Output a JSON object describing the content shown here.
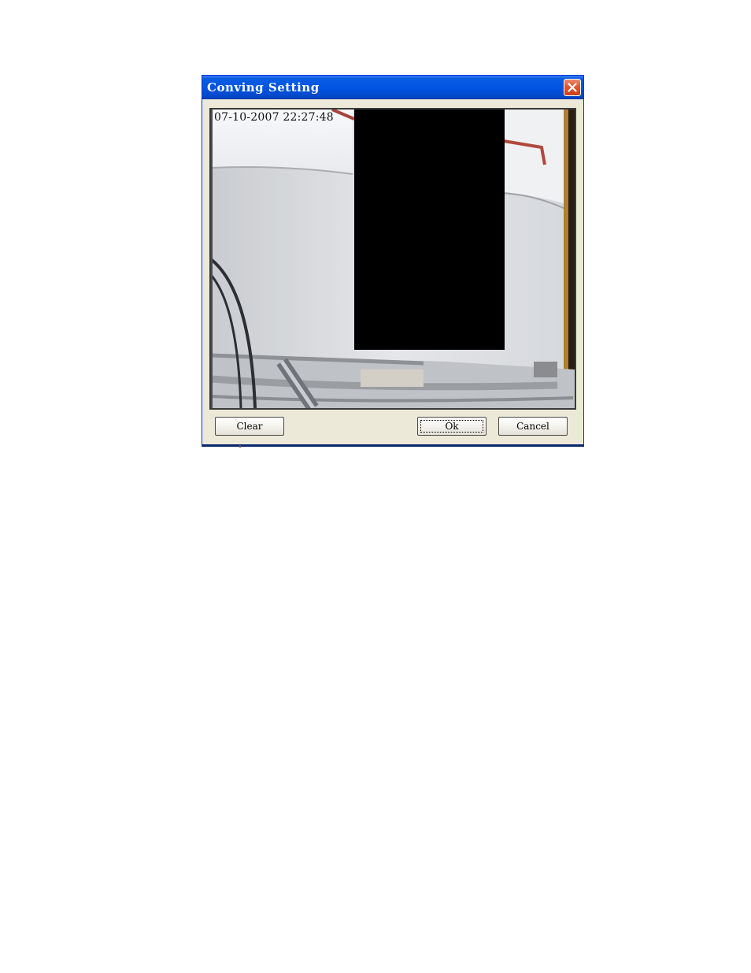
{
  "window": {
    "title": "Conving Setting"
  },
  "video": {
    "timestamp": "07-10-2007 22:27:48"
  },
  "buttons": {
    "clear": "Clear",
    "ok": "Ok",
    "cancel": "Cancel"
  },
  "colors": {
    "titlebar": "#0054e3",
    "close": "#e3572e",
    "mask": "#000000",
    "dialog_bg": "#ece9d8"
  },
  "icons": {
    "close": "close-icon"
  }
}
